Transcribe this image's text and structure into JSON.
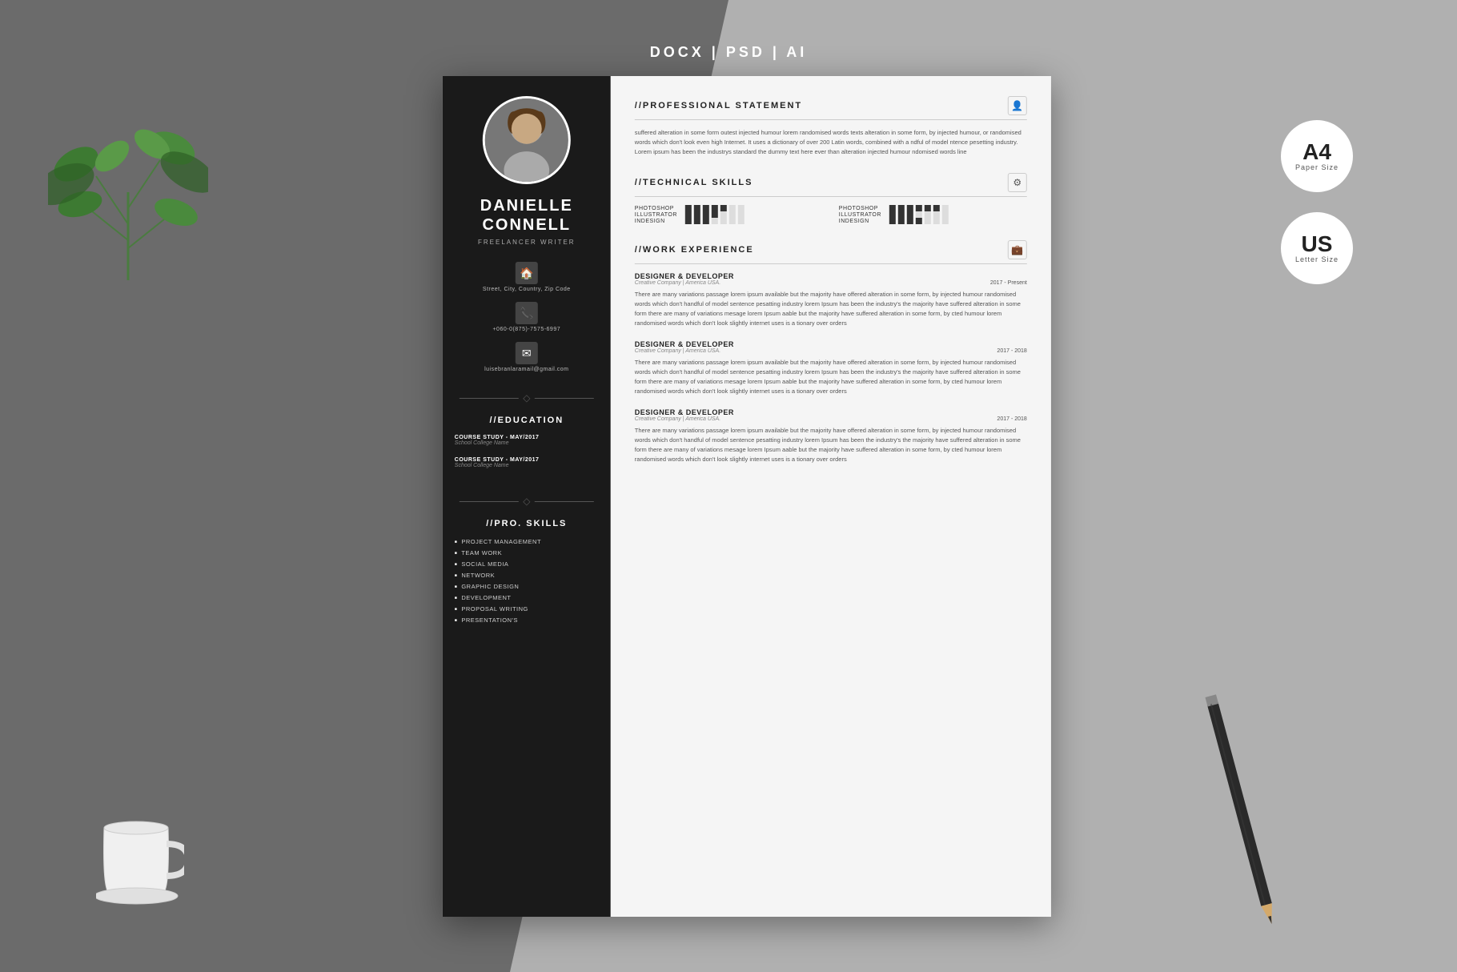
{
  "page": {
    "top_label": "DOCX | PSD | AI",
    "badge_a4": {
      "main": "A4",
      "sub": "Paper Size"
    },
    "badge_us": {
      "main": "US",
      "sub": "Letter Size"
    }
  },
  "resume": {
    "sidebar": {
      "name_line1": "DANIELLE",
      "name_line2": "CONNELL",
      "title": "FREELANCER WRITER",
      "contact": {
        "address": "Street, City, Country, Zip Code",
        "phone": "+060-0(875)-7575-6997",
        "email": "luisebranlaramail@gmail.com"
      },
      "education_title": "//EDUCATION",
      "education_items": [
        {
          "course": "COURSE STUDY - MAY/2017",
          "school": "School College Name"
        },
        {
          "course": "COURSE STUDY - MAY/2017",
          "school": "School College Name"
        }
      ],
      "pro_skills_title": "//PRO. SKILLS",
      "pro_skills": [
        "PROJECT MANAGEMENT",
        "TEAM WORK",
        "SOCIAL MEDIA",
        "NETWORK",
        "GRAPHIC DESIGN",
        "DEVELOPMENT",
        "PROPOSAL WRITING",
        "PRESENTATION'S"
      ]
    },
    "main": {
      "professional_statement": {
        "title": "//PROFESSIONAL STATEMENT",
        "body": "suffered alteration in some form outest injected humour lorem randomised words texts alteration in some form, by injected humour, or randomised words which don't look even high Internet. It uses a dictionary of over 200 Latin words, combined with a ndful of model ntence pesetting industry. Lorem ipsum has been the industrys standard the dummy text here ever than alteration injected humour ndomised words line"
      },
      "technical_skills": {
        "title": "//TECHNICAL SKILLS",
        "skills_left": [
          {
            "name": "PHOTOSHOP",
            "filled": 5,
            "empty": 2
          },
          {
            "name": "ILLUSTRATOR",
            "filled": 4,
            "empty": 3
          },
          {
            "name": "INDESIGN",
            "filled": 3,
            "empty": 4
          }
        ],
        "skills_right": [
          {
            "name": "PHOTOSHOP",
            "filled": 6,
            "empty": 1
          },
          {
            "name": "ILLUSTRATOR",
            "filled": 3,
            "empty": 4
          },
          {
            "name": "INDESIGN",
            "filled": 4,
            "empty": 3
          }
        ]
      },
      "work_experience": {
        "title": "//WORK EXPERIENCE",
        "jobs": [
          {
            "title": "DESIGNER & DEVELOPER",
            "company": "Creative Company | America USA.",
            "date": "2017 - Present",
            "desc": "There are many variations passage lorem ipsum available but the majority have offered alteration in some form, by injected humour randomised words which don't handful of model sentence pesatting industry lorem Ipsum has been the industry's the majority have suffered alteration in some form there are many of variations mesage lorem Ipsum aable but the majority have suffered alteration in some form, by cted humour lorem randomised words which don't look slightly internet uses is a tionary over orders"
          },
          {
            "title": "DESIGNER & DEVELOPER",
            "company": "Creative Company | America USA.",
            "date": "2017 - 2018",
            "desc": "There are many variations passage lorem ipsum available but the majority have offered alteration in some form, by injected humour randomised words which don't handful of model sentence pesatting industry lorem Ipsum has been the industry's the majority have suffered alteration in some form there are many of variations mesage lorem Ipsum aable but the majority have suffered alteration in some form, by cted humour lorem randomised words which don't look slightly internet uses is a tionary over orders"
          },
          {
            "title": "DESIGNER & DEVELOPER",
            "company": "Creative Company | America USA.",
            "date": "2017 - 2018",
            "desc": "There are many variations passage lorem ipsum available but the majority have offered alteration in some form, by injected humour randomised words which don't handful of model sentence pesatting industry lorem Ipsum has been the industry's the majority have suffered alteration in some form there are many of variations mesage lorem Ipsum aable but the majority have suffered alteration in some form, by cted humour lorem randomised words which don't look slightly internet uses is a tionary over orders"
          }
        ]
      }
    }
  }
}
